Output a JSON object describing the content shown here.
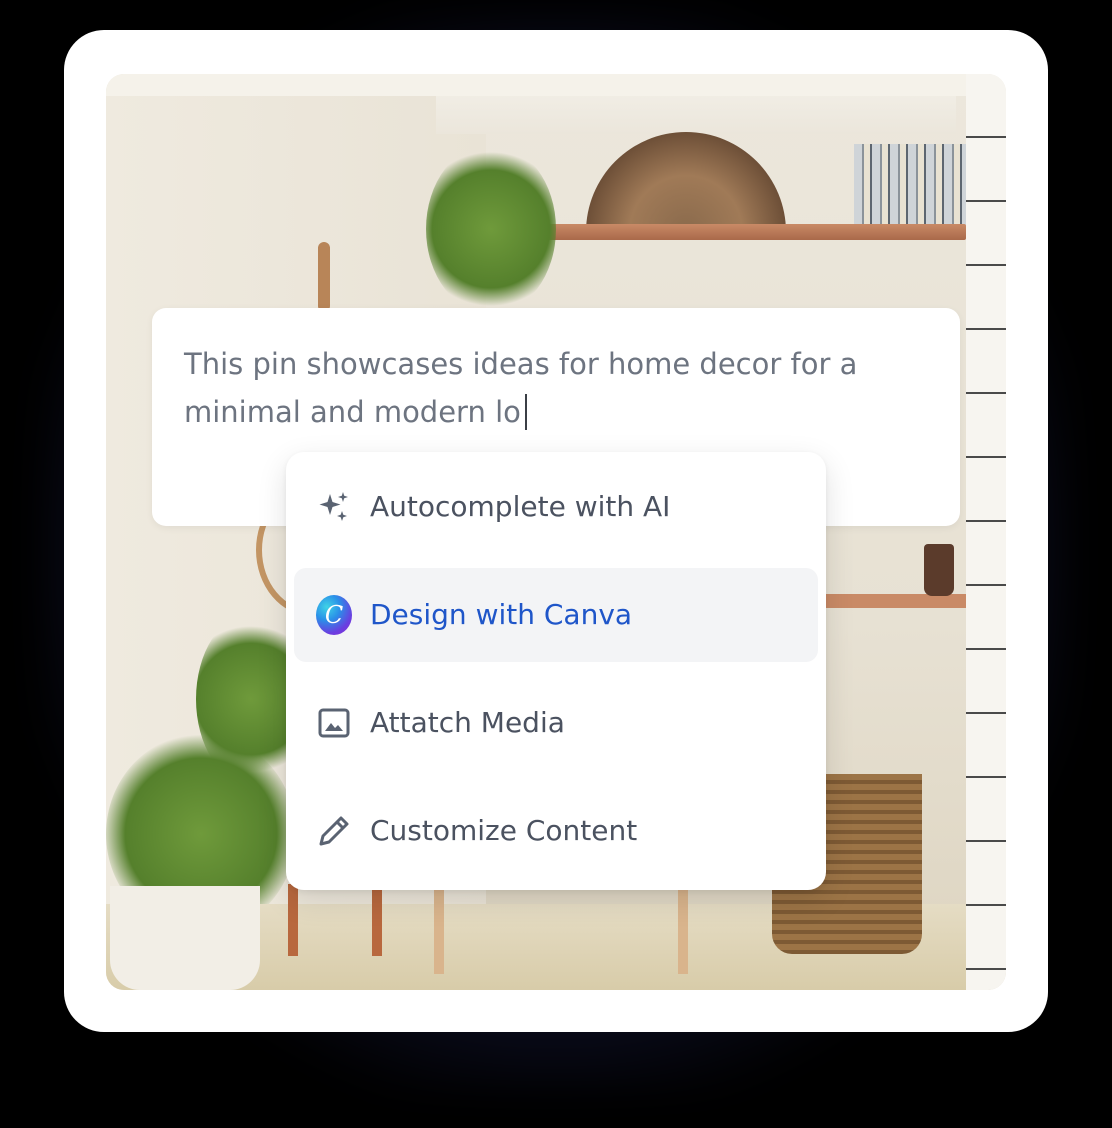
{
  "input": {
    "text": "This pin showcases ideas for home decor for a minimal and modern lo"
  },
  "menu": {
    "items": [
      {
        "label": "Autocomplete with AI",
        "icon": "sparkles-icon",
        "active": false
      },
      {
        "label": "Design with Canva",
        "icon": "canva-logo-icon",
        "icon_text": "C",
        "active": true
      },
      {
        "label": "Attatch Media",
        "icon": "image-icon",
        "active": false
      },
      {
        "label": "Customize Content",
        "icon": "pencil-icon",
        "active": false
      }
    ]
  },
  "colors": {
    "active_label": "#1f56c9",
    "active_bg": "#f3f4f6",
    "text_muted": "#6d7480",
    "menu_text": "#4b5260"
  }
}
